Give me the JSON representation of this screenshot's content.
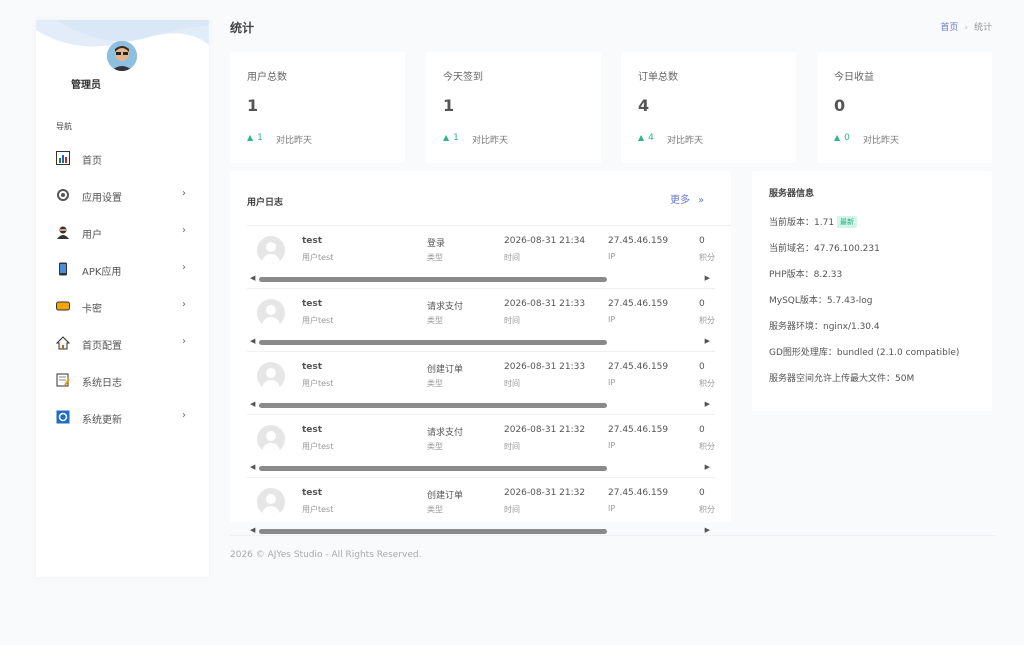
{
  "sidebar": {
    "admin_name": "管理员",
    "nav_title": "导航",
    "items": [
      {
        "label": "首页",
        "icon": "bar-chart-icon",
        "chevron": ""
      },
      {
        "label": "应用设置",
        "icon": "gear-icon",
        "chevron": "›"
      },
      {
        "label": "用户",
        "icon": "user-icon",
        "chevron": "›"
      },
      {
        "label": "APK应用",
        "icon": "phone-icon",
        "chevron": "›"
      },
      {
        "label": "卡密",
        "icon": "card-icon",
        "chevron": "›"
      },
      {
        "label": "首页配置",
        "icon": "home-icon",
        "chevron": "›"
      },
      {
        "label": "系统日志",
        "icon": "notepad-icon",
        "chevron": ""
      },
      {
        "label": "系统更新",
        "icon": "refresh-icon",
        "chevron": "›"
      }
    ]
  },
  "header": {
    "title": "统计",
    "breadcrumb_home": "首页",
    "breadcrumb_sep": "›",
    "breadcrumb_current": "统计"
  },
  "stats": [
    {
      "title": "用户总数",
      "value": "1",
      "delta": "1",
      "compare": "对比昨天"
    },
    {
      "title": "今天签到",
      "value": "1",
      "delta": "1",
      "compare": "对比昨天"
    },
    {
      "title": "订单总数",
      "value": "4",
      "delta": "4",
      "compare": "对比昨天"
    },
    {
      "title": "今日收益",
      "value": "0",
      "delta": "0",
      "compare": "对比昨天"
    }
  ],
  "log": {
    "title": "用户日志",
    "more": "更多",
    "more_icon": "»",
    "rows": [
      {
        "name": "test",
        "user": "用户test",
        "action": "登录",
        "action_label": "类型",
        "time": "2026-08-31 21:34",
        "time_label": "时间",
        "ip": "27.45.46.159",
        "ip_label": "IP",
        "points": "0",
        "points_label": "积分"
      },
      {
        "name": "test",
        "user": "用户test",
        "action": "请求支付",
        "action_label": "类型",
        "time": "2026-08-31 21:33",
        "time_label": "时间",
        "ip": "27.45.46.159",
        "ip_label": "IP",
        "points": "0",
        "points_label": "积分"
      },
      {
        "name": "test",
        "user": "用户test",
        "action": "创建订单",
        "action_label": "类型",
        "time": "2026-08-31 21:33",
        "time_label": "时间",
        "ip": "27.45.46.159",
        "ip_label": "IP",
        "points": "0",
        "points_label": "积分"
      },
      {
        "name": "test",
        "user": "用户test",
        "action": "请求支付",
        "action_label": "类型",
        "time": "2026-08-31 21:32",
        "time_label": "时间",
        "ip": "27.45.46.159",
        "ip_label": "IP",
        "points": "0",
        "points_label": "积分"
      },
      {
        "name": "test",
        "user": "用户test",
        "action": "创建订单",
        "action_label": "类型",
        "time": "2026-08-31 21:32",
        "time_label": "时间",
        "ip": "27.45.46.159",
        "ip_label": "IP",
        "points": "0",
        "points_label": "积分"
      }
    ]
  },
  "server": {
    "title": "服务器信息",
    "version_label": "当前版本：1.71",
    "version_badge": "最新",
    "domain": "当前域名：47.76.100.231",
    "php": "PHP版本：8.2.33",
    "mysql": "MySQL版本：5.7.43-log",
    "env": "服务器环境：nginx/1.30.4",
    "gd": "GD图形处理库：bundled (2.1.0 compatible)",
    "upload": "服务器空间允许上传最大文件：50M"
  },
  "footer": {
    "text": "2026 © AJYes Studio - All Rights Reserved."
  },
  "colors": {
    "accent": "#6b78d6",
    "positive": "#2fb58a",
    "background": "#f9fafc"
  }
}
